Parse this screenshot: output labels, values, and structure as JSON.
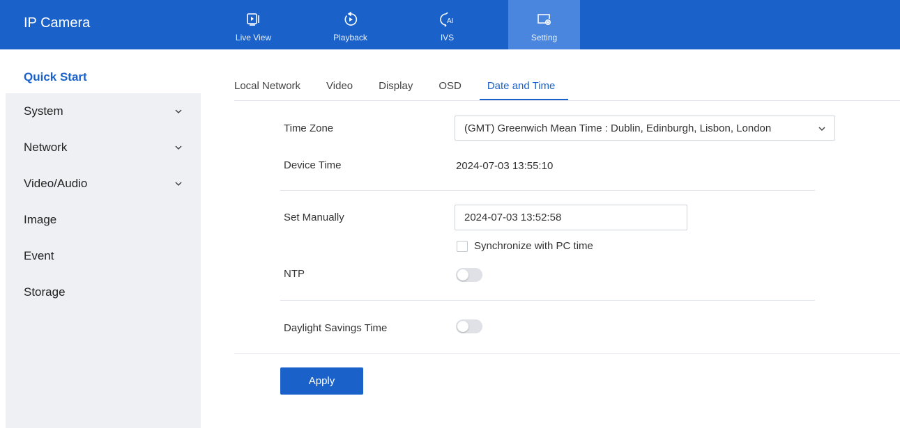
{
  "header": {
    "brand": "IP Camera",
    "nav": [
      {
        "label": "Live View",
        "icon": "live-view-icon"
      },
      {
        "label": "Playback",
        "icon": "playback-icon"
      },
      {
        "label": "IVS",
        "icon": "ai-icon"
      },
      {
        "label": "Setting",
        "icon": "setting-icon",
        "active": true
      }
    ]
  },
  "sidebar": {
    "items": [
      {
        "label": "Quick Start",
        "active": true
      },
      {
        "label": "System",
        "expandable": true
      },
      {
        "label": "Network",
        "expandable": true
      },
      {
        "label": "Video/Audio",
        "expandable": true
      },
      {
        "label": "Image"
      },
      {
        "label": "Event"
      },
      {
        "label": "Storage"
      }
    ]
  },
  "tabs": [
    {
      "label": "Local Network"
    },
    {
      "label": "Video"
    },
    {
      "label": "Display"
    },
    {
      "label": "OSD"
    },
    {
      "label": "Date and Time",
      "active": true
    }
  ],
  "form": {
    "time_zone_label": "Time Zone",
    "time_zone_value": "(GMT) Greenwich Mean Time : Dublin, Edinburgh, Lisbon, London",
    "device_time_label": "Device Time",
    "device_time_value": "2024-07-03 13:55:10",
    "set_manually_label": "Set Manually",
    "set_manually_value": "2024-07-03 13:52:58",
    "sync_pc_label": "Synchronize with PC time",
    "sync_pc_checked": false,
    "ntp_label": "NTP",
    "ntp_enabled": false,
    "dst_label": "Daylight Savings Time",
    "dst_enabled": false,
    "apply_label": "Apply"
  },
  "colors": {
    "primary": "#1a62c9",
    "active_nav": "#4a86dd",
    "sidebar_bg": "#eef0f4"
  }
}
